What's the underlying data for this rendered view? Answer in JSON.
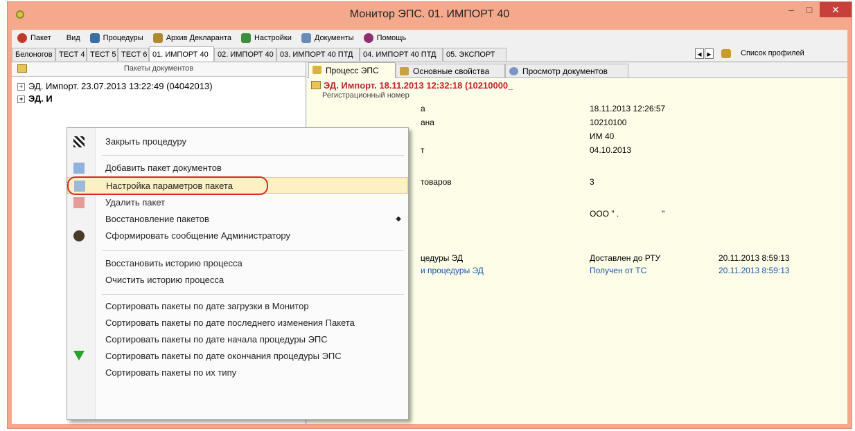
{
  "window": {
    "title": "Монитор ЭПС. 01. ИМПОРТ 40",
    "min": "–",
    "max": "□",
    "close": "✕"
  },
  "menu": [
    {
      "label": "Пакет",
      "icon": "package-icon",
      "color": "#c0392b"
    },
    {
      "label": "Вид",
      "icon": "",
      "color": ""
    },
    {
      "label": "Процедуры",
      "icon": "procedures-icon",
      "color": "#3a6ea5"
    },
    {
      "label": "Архив Декларанта",
      "icon": "archive-icon",
      "color": "#b08a2e"
    },
    {
      "label": "Настройки",
      "icon": "settings-icon",
      "color": "#3e8e3e"
    },
    {
      "label": "Документы",
      "icon": "documents-icon",
      "color": "#6a8bb5"
    },
    {
      "label": "Помощь",
      "icon": "help-icon",
      "color": "#8e2e6e"
    }
  ],
  "profile_tabs": [
    {
      "label": "Белоногов"
    },
    {
      "label": "ТЕСТ 4"
    },
    {
      "label": "ТЕСТ 5"
    },
    {
      "label": "ТЕСТ 6"
    },
    {
      "label": "01. ИМПОРТ 40"
    },
    {
      "label": "02. ИМПОРТ 40"
    },
    {
      "label": "03. ИМПОРТ 40 ПТД"
    },
    {
      "label": "04. ИМПОРТ 40 ПТД"
    },
    {
      "label": "05. ЭКСПОРТ"
    }
  ],
  "profiles_list_label": "Список профилей",
  "left_panel": {
    "header": "Пакеты документов",
    "tree": [
      "ЭД. Импорт. 23.07.2013 13:22:49 (04042013)",
      "ЭД. И"
    ]
  },
  "right_tabs": [
    "Процесс ЭПС",
    "Основные свойства",
    "Просмотр документов"
  ],
  "package": {
    "title": "ЭД. Импорт. 18.11.2013 12:32:18 (10210000_",
    "sub": "Регистрационный номер",
    "label_a": "а",
    "label_ana": "ана",
    "label_t": "т",
    "label_goods": "товаров",
    "values": [
      "18.11.2013 12:26:57",
      "10210100",
      "ИМ 40",
      "04.10.2013",
      "3",
      "ООО \" .",
      "\""
    ],
    "events": [
      {
        "procedure": "цедуры ЭД",
        "status": "Доставлен до РТУ",
        "time": "20.11.2013 8:59:13"
      },
      {
        "procedure": "и процедуры ЭД",
        "status": "Получен от ТС",
        "time": "20.11.2013 8:59:13"
      }
    ]
  },
  "context_menu": {
    "items": [
      {
        "label": "Закрыть процедуру",
        "icon": "flag-icon"
      },
      {
        "label": "Добавить пакет документов",
        "icon": "add-package-icon"
      },
      {
        "label": "Настройка параметров пакета",
        "icon": "package-settings-icon"
      },
      {
        "label": "Удалить пакет",
        "icon": "delete-package-icon"
      },
      {
        "label": "Восстановление пакетов",
        "icon": ""
      },
      {
        "label": "Сформировать сообщение Администратору",
        "icon": "admin-message-icon"
      },
      {
        "label": "Восстановить историю процесса",
        "icon": ""
      },
      {
        "label": "Очистить историю процесса",
        "icon": ""
      },
      {
        "label": "Сортировать пакеты по дате загрузки в Монитор",
        "icon": ""
      },
      {
        "label": "Сортировать пакеты по дате последнего изменения Пакета",
        "icon": ""
      },
      {
        "label": "Сортировать пакеты по дате начала процедуры ЭПС",
        "icon": ""
      },
      {
        "label": "Сортировать пакеты по дате окончания процедуры ЭПС",
        "icon": "sort-triangle-icon"
      },
      {
        "label": "Сортировать пакеты по их типу",
        "icon": ""
      }
    ],
    "submenu_arrow": "◆"
  },
  "colors": {
    "titlebar": "#f4a98c",
    "close_button": "#c7413c",
    "package_title": "#c8202a",
    "link_blue": "#1a57a8",
    "highlight_ring": "#d42a2a"
  }
}
